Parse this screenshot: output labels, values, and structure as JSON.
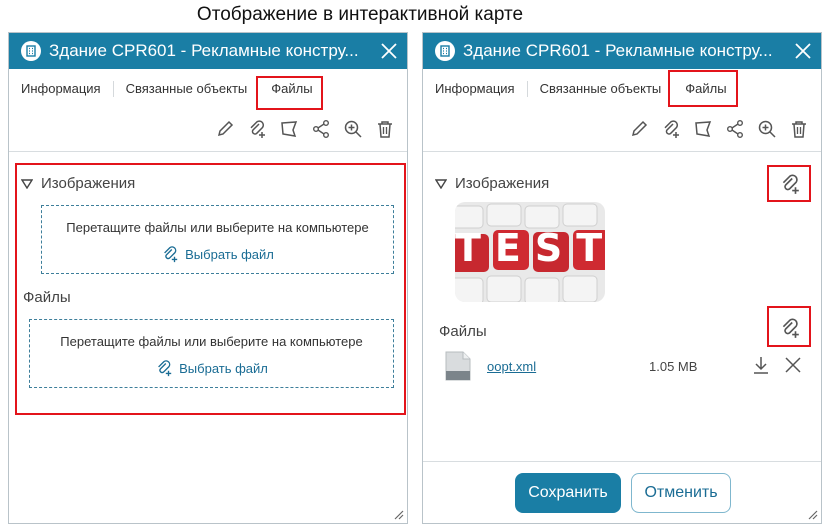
{
  "caption": "Отображение в интерактивной карте",
  "panels": [
    {
      "title": "Здание CPR601 - Рекламные констру...",
      "tabs": [
        "Информация",
        "Связанные объекты",
        "Файлы"
      ],
      "images_section": "Изображения",
      "files_section": "Файлы",
      "drop_hint": "Перетащите файлы или выберите на компьютере",
      "pick_label": "Выбрать файл"
    },
    {
      "title": "Здание CPR601 - Рекламные констру...",
      "tabs": [
        "Информация",
        "Связанные объекты",
        "Файлы"
      ],
      "images_section": "Изображения",
      "files_section": "Файлы",
      "file": {
        "name": "oopt.xml",
        "size": "1.05 MB"
      },
      "thumb_word": "TEST",
      "save_label": "Сохранить",
      "cancel_label": "Отменить"
    }
  ],
  "colors": {
    "accent": "#1a7ea5",
    "highlight": "#e3141b"
  },
  "icons": [
    "building-icon",
    "close-icon",
    "edit-icon",
    "attach-icon",
    "geometry-icon",
    "share-icon",
    "zoom-icon",
    "delete-icon",
    "download-icon",
    "remove-icon",
    "file-icon"
  ]
}
